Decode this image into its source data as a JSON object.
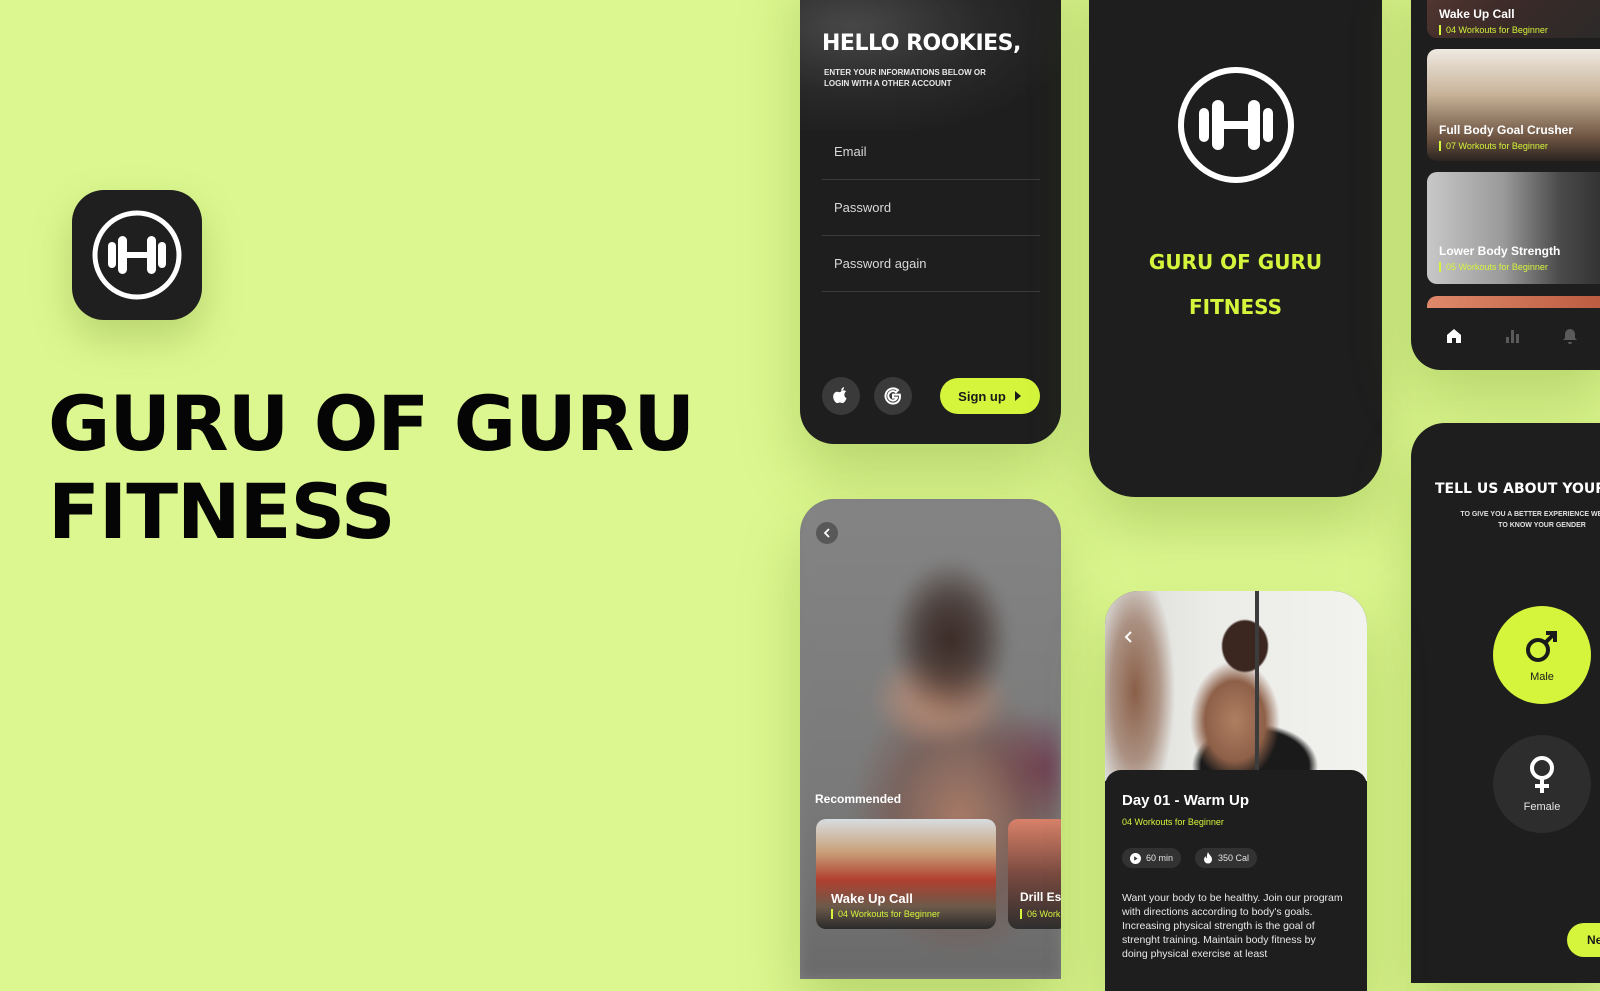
{
  "brand": {
    "title_line1": "GURU OF GURU",
    "title_line2": "FITNESS"
  },
  "signup": {
    "hello": "HELLO",
    "rookies": "ROOKIES,",
    "subtitle": "ENTER YOUR INFORMATIONS BELOW OR LOGIN WITH A OTHER ACCOUNT",
    "email_label": "Email",
    "password_label": "Password",
    "password_again_label": "Password again",
    "signup_label": "Sign up"
  },
  "splash": {
    "line1": "GURU OF GURU",
    "line2": "FITNESS"
  },
  "programs": [
    {
      "title": "Wake Up Call",
      "workouts": "04 Workouts",
      "level": "for Beginner"
    },
    {
      "title": "Full Body Goal Crusher",
      "workouts": "07 Workouts",
      "level": "for Beginner"
    },
    {
      "title": "Lower Body Strength",
      "workouts": "05 Workouts",
      "level": "for Beginner"
    }
  ],
  "gender": {
    "title": "TELL US ABOUT YOUR",
    "subtitle": "TO GIVE YOU A BETTER EXPERIENCE WE NEED TO KNOW YOUR GENDER",
    "male": "Male",
    "female": "Female",
    "next": "Ne"
  },
  "recommended": {
    "heading": "Recommended",
    "cards": [
      {
        "title": "Wake Up Call",
        "workouts": "04 Workouts",
        "level": "for Beginner"
      },
      {
        "title": "Drill Es",
        "workouts": "06 Work"
      }
    ]
  },
  "workout": {
    "title": "Day 01 - Warm Up",
    "meta": "04 Workouts for Beginner",
    "duration": "60 min",
    "calories": "350 Cal",
    "description": "Want your body to be healthy. Join our program with directions according to body's goals. Increasing physical strength is the goal of strenght training. Maintain body fitness by doing physical exercise at least"
  },
  "colors": {
    "background": "#dcf78f",
    "accent": "#d4f53c",
    "phone": "#1e1e1e"
  }
}
